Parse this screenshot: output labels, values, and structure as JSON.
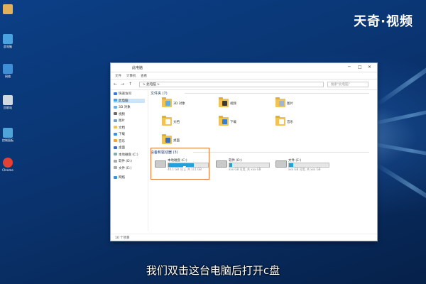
{
  "brand": "天奇·视频",
  "subtitle": "我们双击这台电脑后打开c盘",
  "desktop_icons": [
    {
      "name": "user-folder-icon",
      "label": "",
      "color": "#e0b15a"
    },
    {
      "name": "this-pc-icon",
      "label": "此电脑",
      "color": "#4aa3e0"
    },
    {
      "name": "network-icon",
      "label": "网络",
      "color": "#3f8fd6"
    },
    {
      "name": "recycle-bin-icon",
      "label": "回收站",
      "color": "#d0d8e0"
    },
    {
      "name": "control-panel-icon",
      "label": "控制面板",
      "color": "#4fa3d8"
    },
    {
      "name": "chrome-icon",
      "label": "Chrome",
      "color": "#e44134"
    }
  ],
  "window": {
    "title": "此电脑",
    "ribbon": [
      "文件",
      "计算机",
      "查看"
    ],
    "address": "> 此电脑 >",
    "search_placeholder": "搜索\"此电脑\"",
    "sidebar": [
      {
        "label": "快速访问",
        "color": "#3e7bd6"
      },
      {
        "label": "此电脑",
        "color": "#4aa3e0",
        "active": true
      },
      {
        "label": "3D 对象",
        "color": "#6ab0e6"
      },
      {
        "label": "视频",
        "color": "#6a6a6a"
      },
      {
        "label": "图片",
        "color": "#7aa0c0"
      },
      {
        "label": "文档",
        "color": "#f2c253"
      },
      {
        "label": "下载",
        "color": "#3e8fd6"
      },
      {
        "label": "音乐",
        "color": "#f2a33a"
      },
      {
        "label": "桌面",
        "color": "#3a6fc0"
      },
      {
        "label": "本地磁盘 (C:)",
        "color": "#8aa"
      },
      {
        "label": "软件 (D:)",
        "color": "#aaa"
      },
      {
        "label": "文件 (E:)",
        "color": "#aaa"
      },
      {
        "label": "网络",
        "color": "#3f8fd6"
      }
    ],
    "folders_header": "文件夹 (7)",
    "folders": [
      {
        "label": "3D 对象",
        "overlay": "#5ab0e6"
      },
      {
        "label": "视频",
        "overlay": "#3a3a3a"
      },
      {
        "label": "图片",
        "overlay": "#9bb8d6"
      },
      {
        "label": "文档",
        "overlay": "#ffffff"
      },
      {
        "label": "下载",
        "overlay": "#2f84d2"
      },
      {
        "label": "音乐",
        "overlay": "#ffffff"
      },
      {
        "label": "桌面",
        "overlay": "#3a6fc0"
      }
    ],
    "drives_header": "设备和驱动器 (3)",
    "drives": [
      {
        "name": "本地磁盘 (C:)",
        "size": "40.1 GB 可用, 共 111 GB",
        "used": 0.64,
        "color": "#26a0da"
      },
      {
        "name": "软件 (D:)",
        "size": "xxx GB 可用, 共 xxx GB",
        "used": 0.08,
        "color": "#26a0da"
      },
      {
        "name": "文件 (E:)",
        "size": "xxx GB 可用, 共 xxx GB",
        "used": 0.1,
        "color": "#26a0da"
      }
    ],
    "status": "10 个项目"
  }
}
